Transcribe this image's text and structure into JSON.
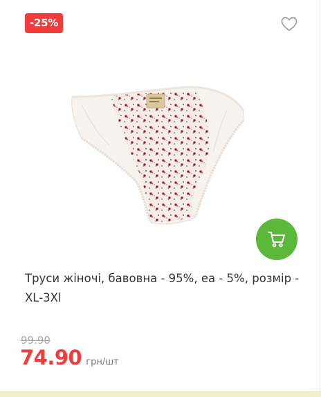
{
  "product": {
    "discount_badge": "-25%",
    "title": "Труси жіночі, бавовна - 95%, еа - 5%, розмір - XL-3Xl",
    "old_price": "99.90",
    "price": "74.90",
    "unit": "грн/шт"
  },
  "icons": {
    "favorite": "heart-outline-icon",
    "cart": "shopping-cart-icon"
  },
  "colors": {
    "badge": "#ef3c3c",
    "price": "#ef3c3c",
    "cart_button": "#5cb83a",
    "old_price": "#a8a8a8"
  }
}
